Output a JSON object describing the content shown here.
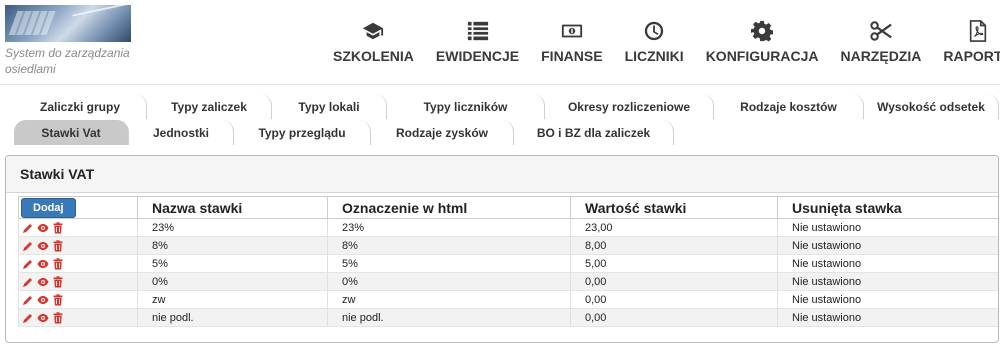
{
  "header": {
    "tagline": "System do zarządzania osiedlami",
    "nav": [
      {
        "label": "SZKOLENIA",
        "icon": "graduation-cap-icon"
      },
      {
        "label": "EWIDENCJE",
        "icon": "list-icon"
      },
      {
        "label": "FINANSE",
        "icon": "money-icon"
      },
      {
        "label": "LICZNIKI",
        "icon": "clock-icon"
      },
      {
        "label": "KONFIGURACJA",
        "icon": "gear-icon"
      },
      {
        "label": "NARZĘDZIA",
        "icon": "scissors-icon"
      },
      {
        "label": "RAPORTY",
        "icon": "pdf-icon"
      }
    ]
  },
  "tabs": {
    "row1": [
      "Zaliczki grupy",
      "Typy zaliczek",
      "Typy lokali",
      "Typy liczników",
      "Okresy rozliczeniowe",
      "Rodzaje kosztów",
      "Wysokość odsetek"
    ],
    "row2": [
      "Stawki Vat",
      "Jednostki",
      "Typy przeglądu",
      "Rodzaje zysków",
      "BO i BZ dla zaliczek"
    ],
    "active": "Stawki Vat"
  },
  "panel": {
    "title": "Stawki VAT",
    "add_label": "Dodaj",
    "columns": [
      "Nazwa stawki",
      "Oznaczenie w html",
      "Wartość stawki",
      "Usunięta stawka"
    ],
    "rows": [
      [
        "23%",
        "23%",
        "23,00",
        "Nie ustawiono"
      ],
      [
        "8%",
        "8%",
        "8,00",
        "Nie ustawiono"
      ],
      [
        "5%",
        "5%",
        "5,00",
        "Nie ustawiono"
      ],
      [
        "0%",
        "0%",
        "0,00",
        "Nie ustawiono"
      ],
      [
        "zw",
        "zw",
        "0,00",
        "Nie ustawiono"
      ],
      [
        "nie podl.",
        "nie podl.",
        "0,00",
        "Nie ustawiono"
      ]
    ]
  },
  "colors": {
    "accent": "#3a78b8",
    "icon_red": "#d9342b",
    "nav_icon": "#3a3a3a"
  }
}
